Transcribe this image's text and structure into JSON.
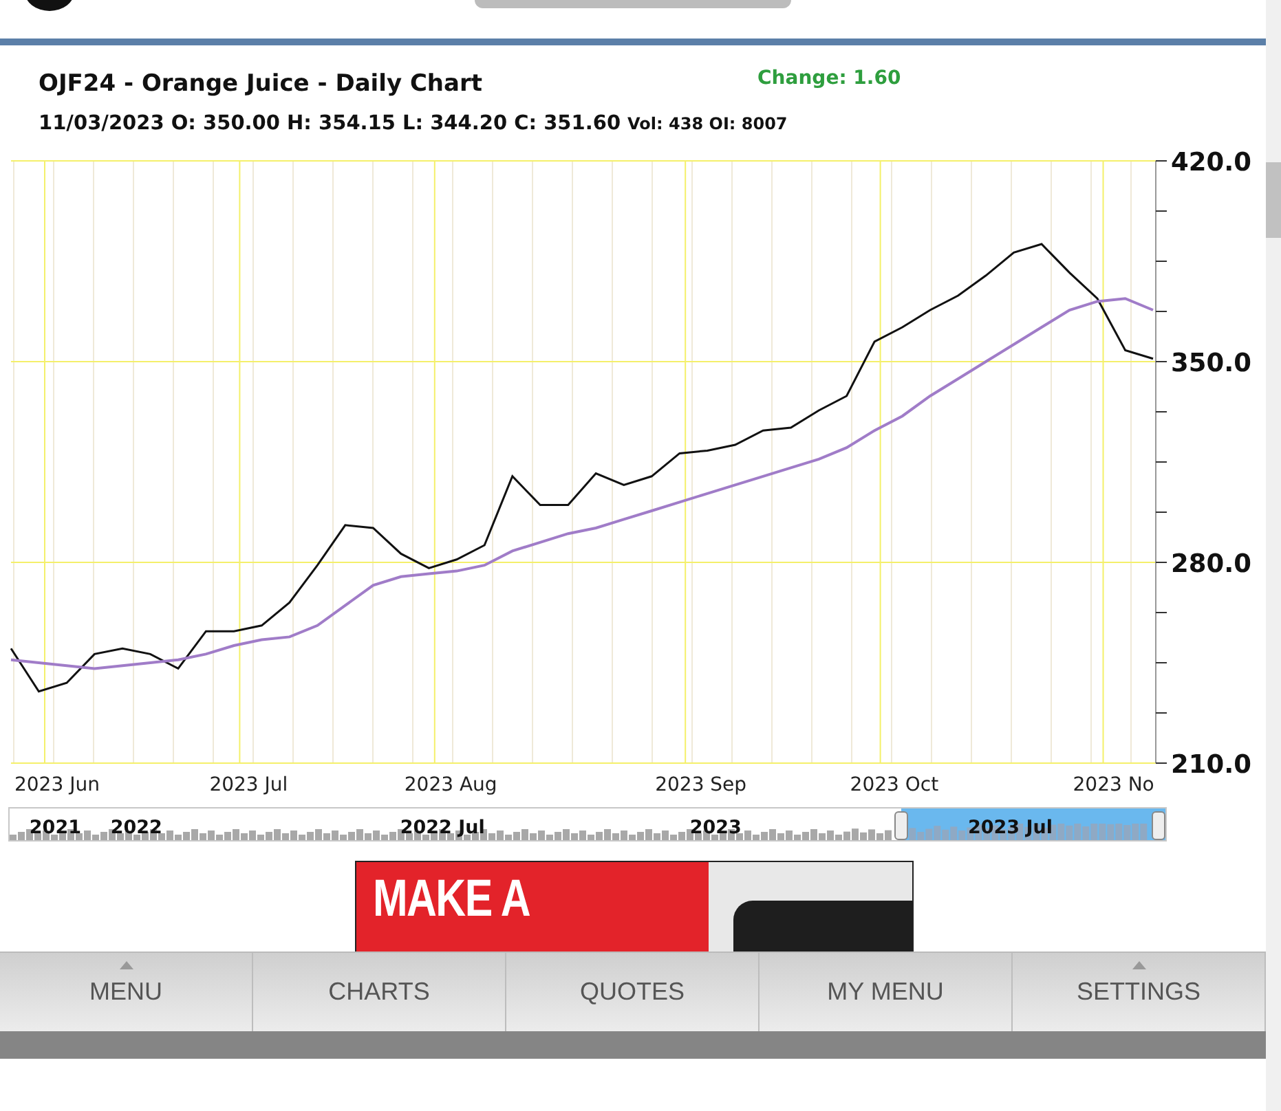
{
  "header": {
    "title": "OJF24 - Orange Juice - Daily Chart",
    "change": "Change: 1.60",
    "ohlc": "11/03/2023 O: 350.00 H: 354.15 L: 344.20 C: 351.60",
    "volume": "Vol: 438 OI: 8007"
  },
  "chart": {
    "chart_data": {
      "type": "line",
      "categories": [
        null,
        null,
        "2023 Jun",
        null,
        null,
        null,
        null,
        null,
        null,
        "2023 Jul",
        null,
        null,
        null,
        null,
        null,
        null,
        "2023 Aug",
        null,
        null,
        null,
        null,
        null,
        null,
        null,
        null,
        "2023 Sep",
        null,
        null,
        null,
        null,
        null,
        null,
        "2023 Oct",
        null,
        null,
        null,
        null,
        null,
        null,
        null,
        "2023 No",
        null
      ],
      "series": [
        {
          "color": "#111111",
          "values": [
            250,
            235,
            238,
            248,
            250,
            248,
            243,
            256,
            256,
            258,
            266,
            279,
            293,
            292,
            283,
            278,
            281,
            286,
            310,
            300,
            300,
            311,
            307,
            310,
            318,
            319,
            321,
            326,
            327,
            333,
            338,
            357,
            362,
            368,
            373,
            380,
            388,
            391,
            381,
            372,
            354,
            351
          ]
        },
        {
          "color": "#a07cc8",
          "values": [
            246,
            245,
            244,
            243,
            244,
            245,
            246,
            248,
            251,
            253,
            254,
            258,
            265,
            272,
            275,
            276,
            277,
            279,
            284,
            287,
            290,
            292,
            295,
            298,
            301,
            304,
            307,
            310,
            313,
            316,
            320,
            326,
            331,
            338,
            344,
            350,
            356,
            362,
            368,
            371,
            372,
            368
          ]
        }
      ],
      "yticks": [
        {
          "value": 420,
          "label": "420.0"
        },
        {
          "value": 350,
          "label": "350.0"
        },
        {
          "value": 280,
          "label": "280.0"
        },
        {
          "value": 210,
          "label": "210.0"
        }
      ],
      "ylim": [
        210,
        420
      ],
      "grid": true
    }
  },
  "navigator": {
    "labels": [
      "2021",
      "2022",
      "2022 Jul",
      "2023",
      "2023 Jul"
    ]
  },
  "ad": {
    "headline": "MAKE A"
  },
  "bottom_nav": [
    {
      "label": "MENU",
      "caret": true
    },
    {
      "label": "CHARTS",
      "caret": false
    },
    {
      "label": "QUOTES",
      "caret": false
    },
    {
      "label": "MY MENU",
      "caret": false
    },
    {
      "label": "SETTINGS",
      "caret": true
    }
  ]
}
